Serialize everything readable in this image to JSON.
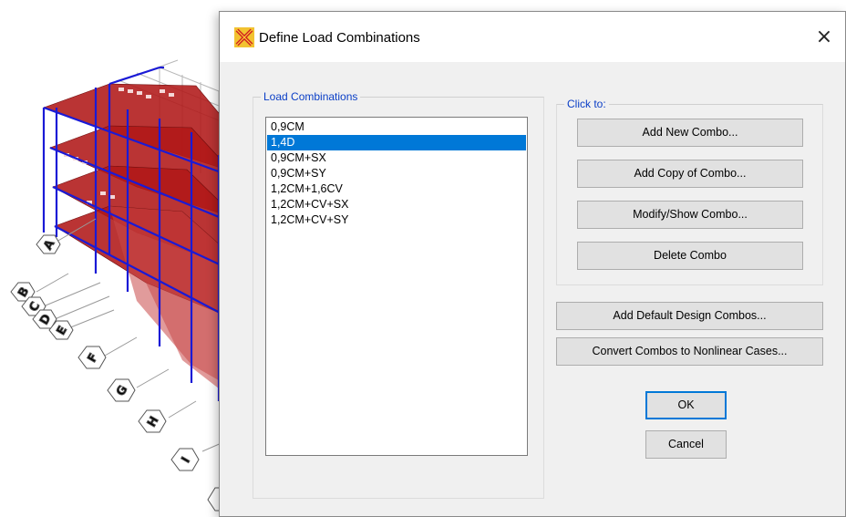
{
  "dialog": {
    "title": "Define Load Combinations",
    "close_glyph": "×"
  },
  "combinations": {
    "group_label": "Load Combinations",
    "selected_index": 1,
    "items": [
      "0,9CM",
      "1,4D",
      "0,9CM+SX",
      "0,9CM+SY",
      "1,2CM+1,6CV",
      "1,2CM+CV+SX",
      "1,2CM+CV+SY"
    ]
  },
  "click_to": {
    "group_label": "Click to:",
    "add_new": "Add New Combo...",
    "add_copy": "Add Copy of Combo...",
    "modify": "Modify/Show Combo...",
    "delete": "Delete Combo"
  },
  "buttons": {
    "add_default": "Add Default Design Combos...",
    "convert": "Convert Combos to Nonlinear Cases...",
    "ok": "OK",
    "cancel": "Cancel"
  },
  "model": {
    "grid_labels": [
      "A",
      "B",
      "C",
      "D",
      "E",
      "F",
      "G",
      "H",
      "I"
    ],
    "colors": {
      "slab": "#b01818",
      "frame": "#1a1ad6",
      "grid": "#b8b8b8"
    }
  },
  "colors": {
    "accent": "#0078d7",
    "group_label": "#0a3ec6"
  }
}
